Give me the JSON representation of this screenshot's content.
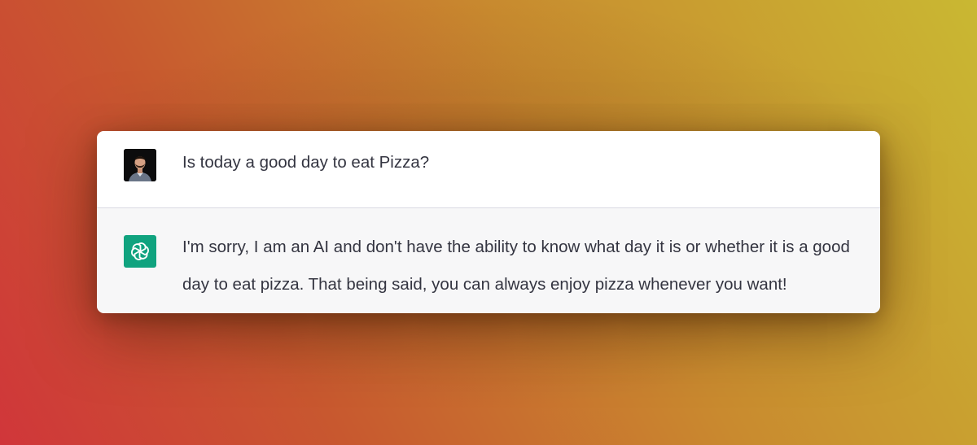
{
  "conversation": {
    "user_message": {
      "avatar_icon": "user-avatar-icon",
      "text": "Is today a good day to eat Pizza?"
    },
    "assistant_message": {
      "avatar_icon": "openai-logo-icon",
      "avatar_color": "#10a37f",
      "text": "I'm sorry, I am an AI and don't have the ability to know what day it is or whether it is a good day to eat pizza. That being said, you can always enjoy pizza whenever you want!"
    }
  },
  "colors": {
    "text": "#343541",
    "assistant_bg": "#f7f7f8",
    "user_bg": "#ffffff"
  }
}
